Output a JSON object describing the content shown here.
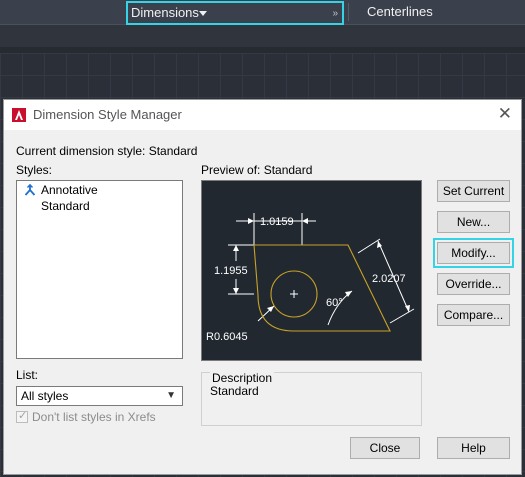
{
  "ribbon": {
    "dimension_dropdown": {
      "value": "Dimensions",
      "icon": "chevron-down-icon",
      "grip": "»"
    },
    "centerlines_label": "Centerlines"
  },
  "dialog": {
    "title": "Dimension Style Manager",
    "close_glyph": "✕",
    "current_style_label": "Current dimension style: Standard",
    "styles_label": "Styles:",
    "styles": [
      {
        "name": "Annotative",
        "icon": "annotative-icon"
      },
      {
        "name": "Standard",
        "icon": ""
      }
    ],
    "preview_label": "Preview of: Standard",
    "preview_dims": {
      "top": "1.0159",
      "left": "1.1955",
      "slant": "2.0207",
      "angle": "60°",
      "radius": "R0.6045"
    },
    "buttons": {
      "set_current": "Set Current",
      "new": "New...",
      "modify": "Modify...",
      "override": "Override...",
      "compare": "Compare...",
      "close": "Close",
      "help": "Help"
    },
    "list_label": "List:",
    "list_value": "All styles",
    "xrefs_label": "Don't list styles in Xrefs",
    "xrefs_checked": true,
    "description_label": "Description",
    "description_value": "Standard"
  },
  "colors": {
    "highlight": "#35d3e6",
    "preview_bg": "#212830",
    "preview_shape": "#c9a227",
    "annotative_blue": "#1f6fd1",
    "app_icon_red": "#c8102e"
  }
}
